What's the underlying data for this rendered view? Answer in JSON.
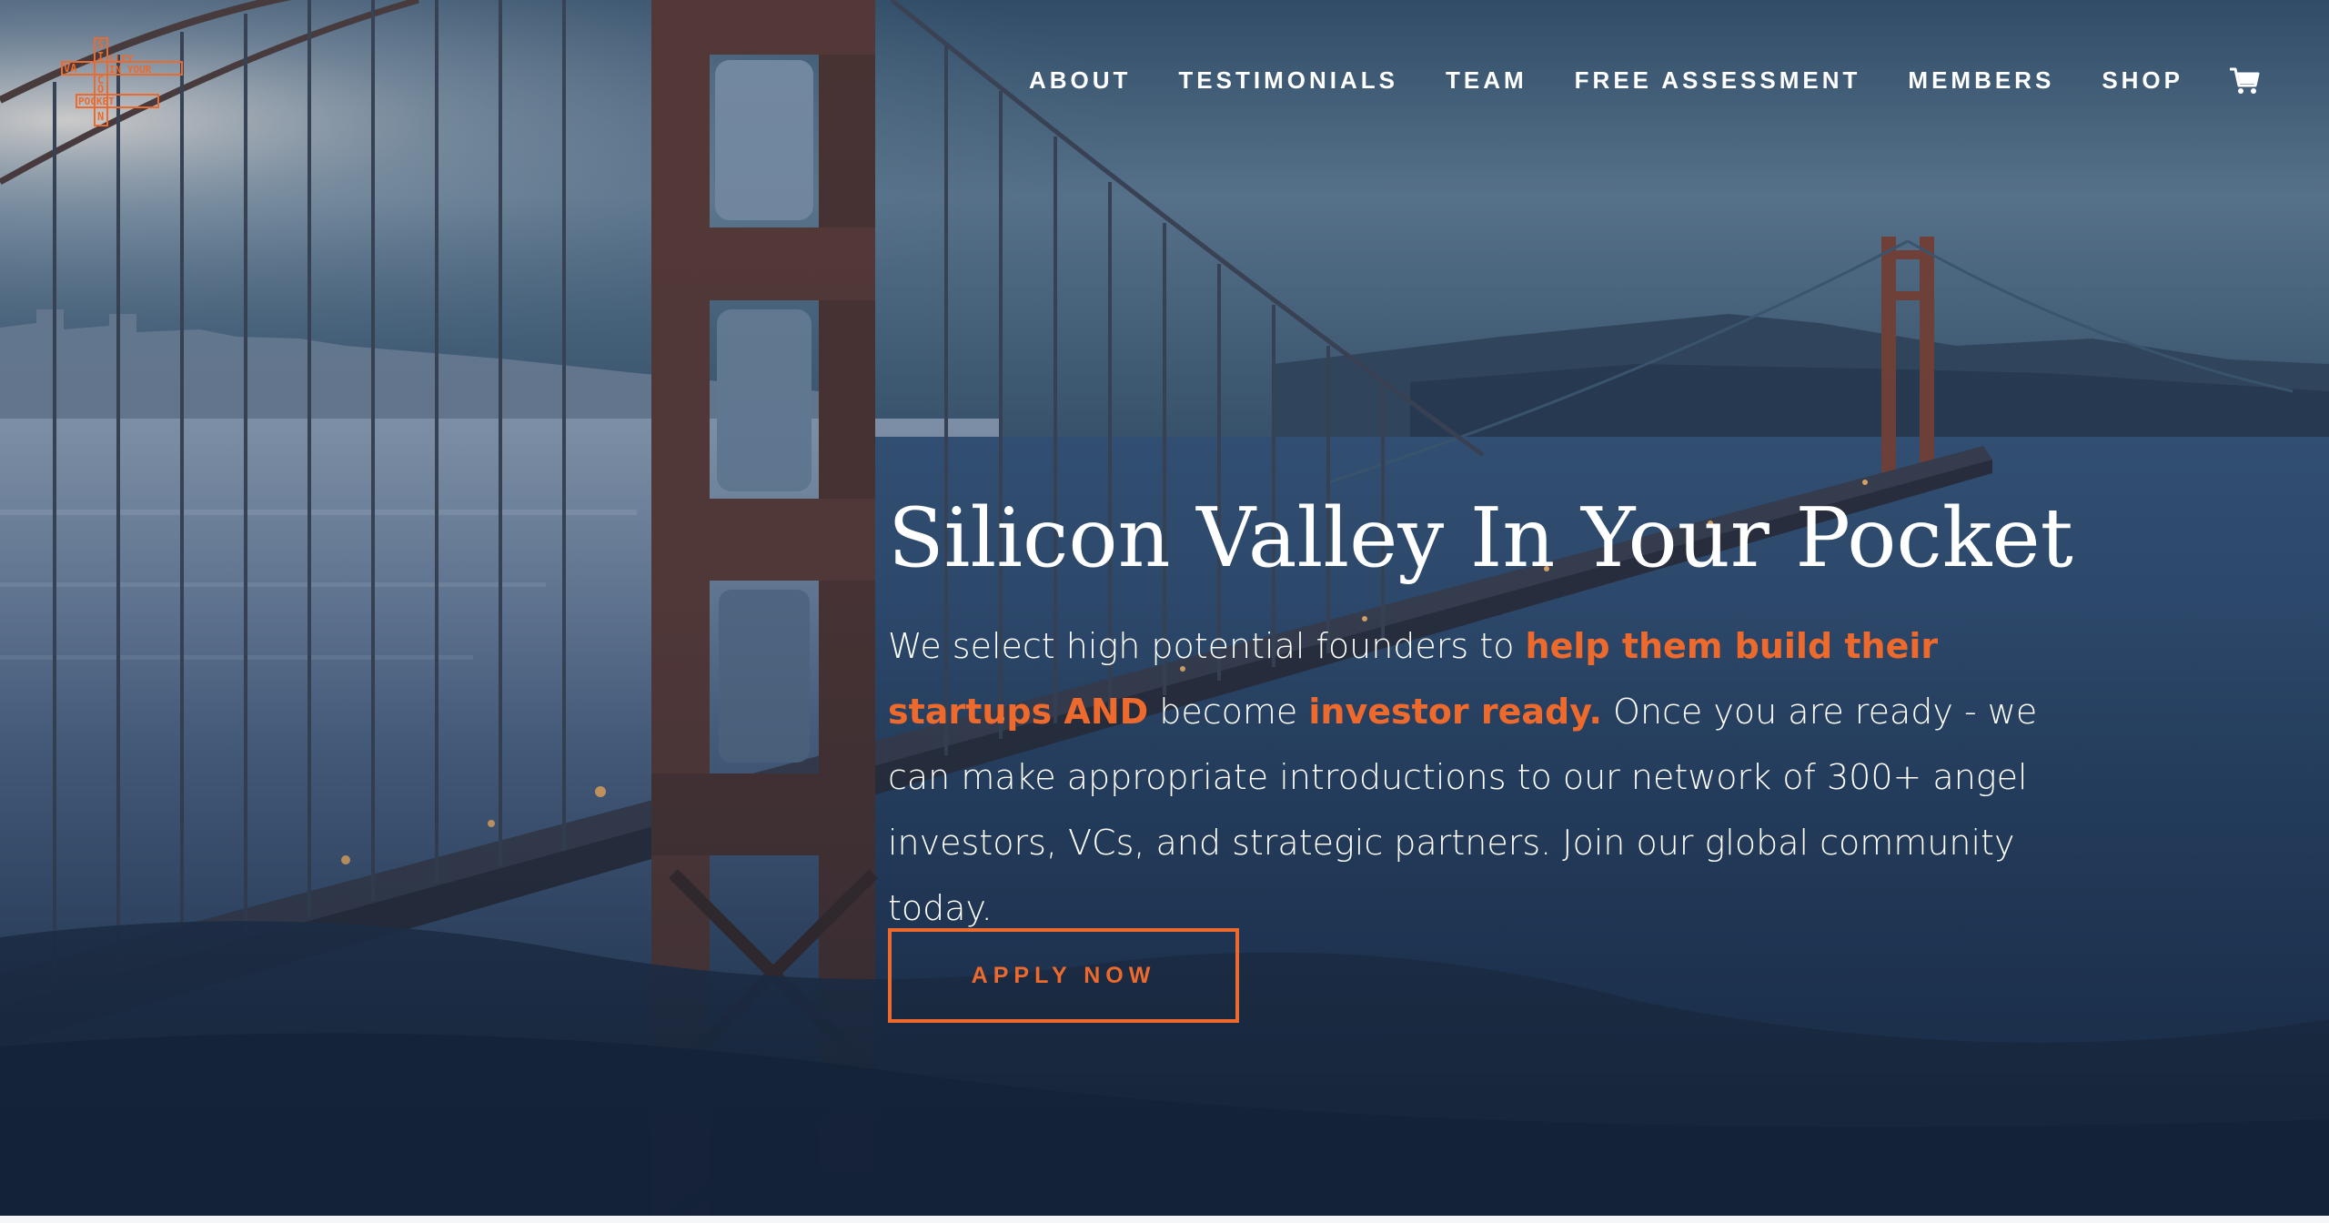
{
  "brand": {
    "logo_lines": [
      "VALLEY",
      "IN YOUR",
      "POCKET"
    ],
    "logo_vertical": "SILICON",
    "accent_color": "#ee6a2c"
  },
  "nav": {
    "items": [
      {
        "label": "ABOUT"
      },
      {
        "label": "TESTIMONIALS"
      },
      {
        "label": "TEAM"
      },
      {
        "label": "FREE ASSESSMENT"
      },
      {
        "label": "MEMBERS"
      },
      {
        "label": "SHOP"
      }
    ],
    "cart_icon": "cart-icon"
  },
  "hero": {
    "headline": "Silicon Valley In Your Pocket",
    "desc": {
      "p1": "We select high potential founders to ",
      "h1": "help them build their startups AND",
      "p2": " become ",
      "h2": "investor ready.",
      "p3": " Once you are ready - we can make appropriate introductions to our network of 300+ angel investors, VCs, and strategic partners. Join our global community today."
    },
    "cta_label": "APPLY NOW",
    "background": "golden-gate-bridge-photo"
  }
}
